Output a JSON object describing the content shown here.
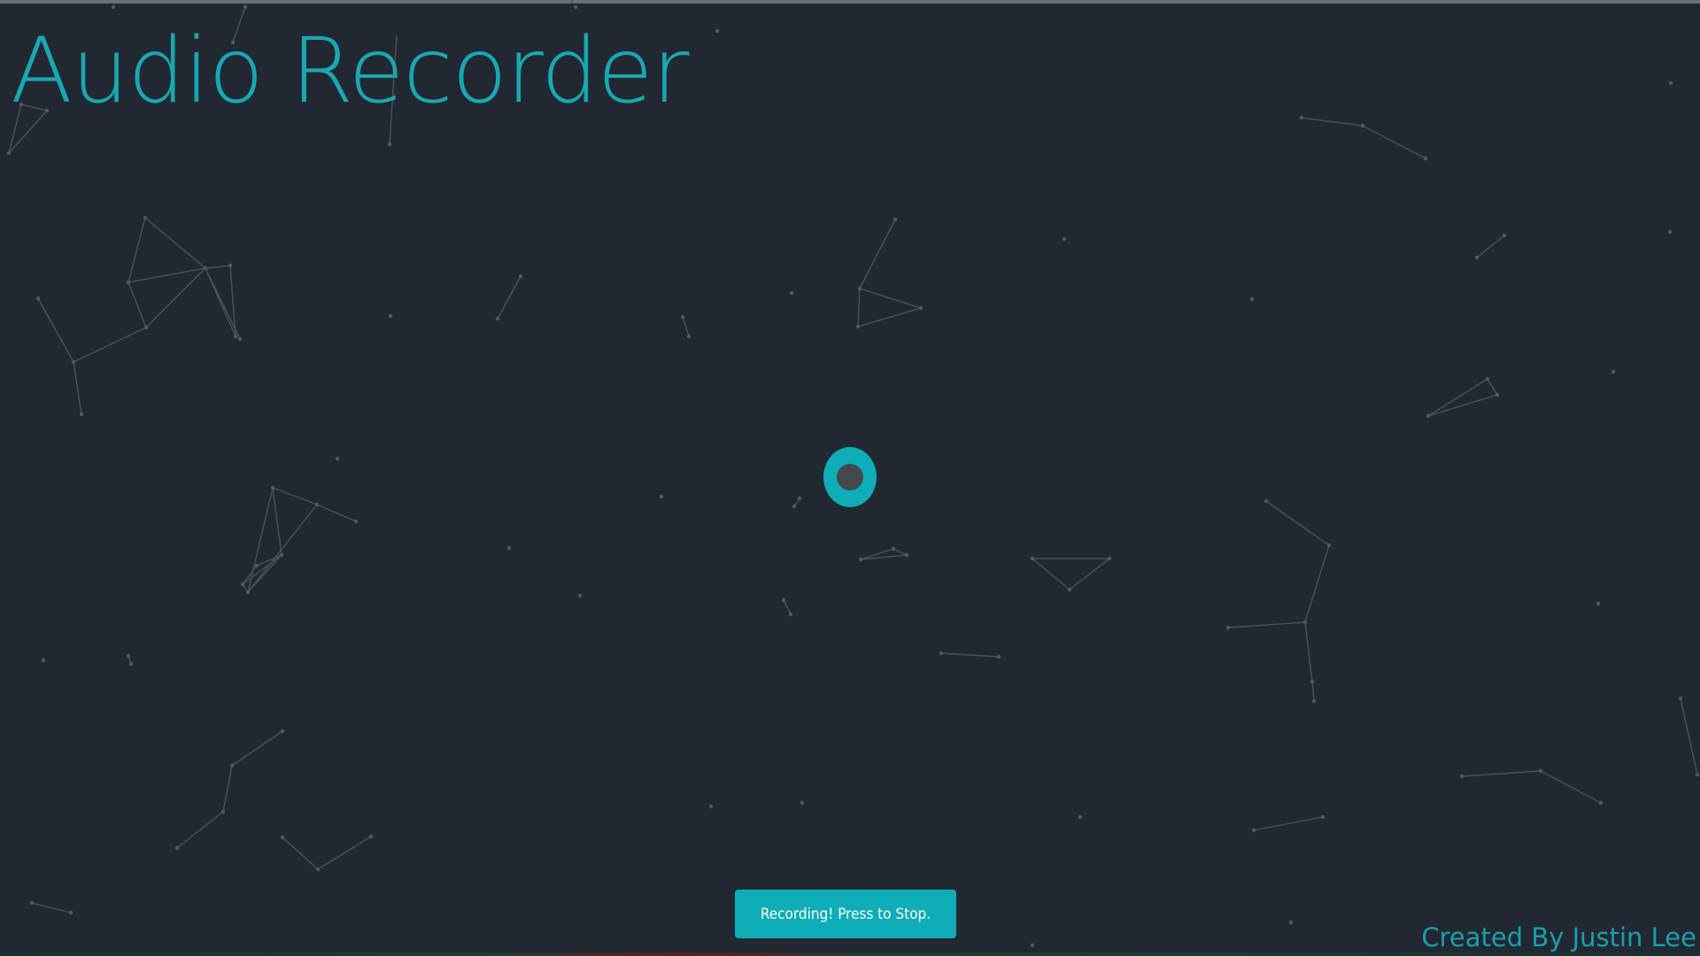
{
  "app": {
    "title": "Audio Recorder",
    "credit": "Created By Justin Lee"
  },
  "recorder": {
    "button_label": "Recording! Press to Stop.",
    "indicator_icon": "record-icon",
    "state": "recording"
  },
  "colors": {
    "background": "#222832",
    "accent": "#0fadb8",
    "constellation": "#4d535c"
  }
}
